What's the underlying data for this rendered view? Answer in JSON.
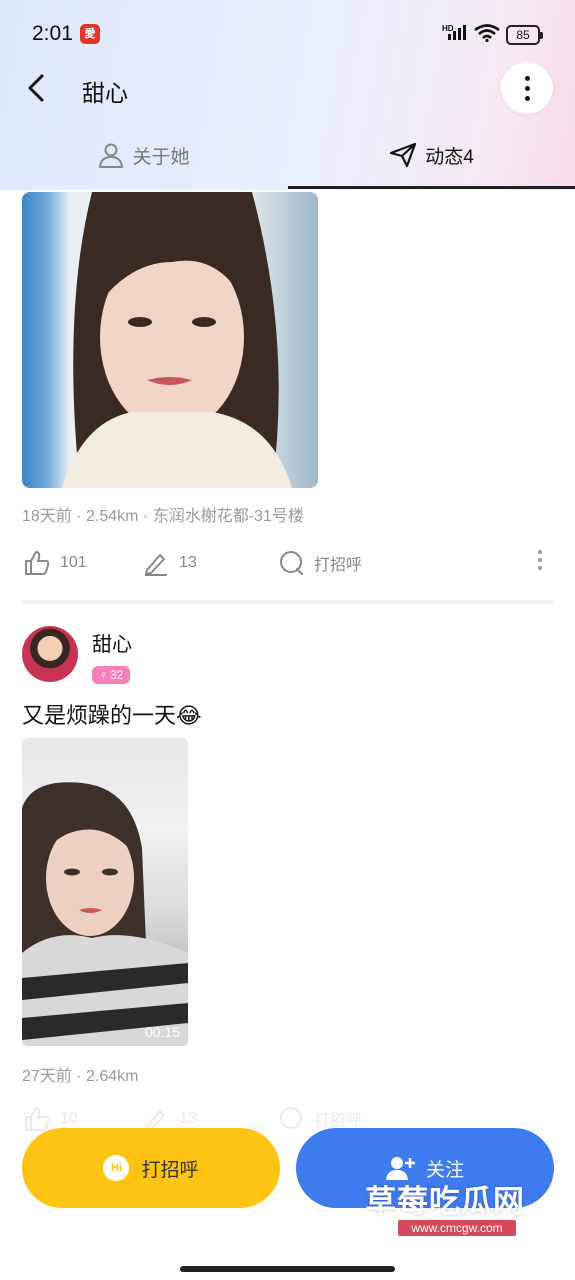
{
  "status_bar": {
    "time": "2:01",
    "app_badge": "愛",
    "signal_label": "HD",
    "battery": "85"
  },
  "nav": {
    "title": "甜心"
  },
  "tabs": {
    "about_label": "关于她",
    "feed_label": "动态4"
  },
  "posts": [
    {
      "meta": "18天前 · 2.54km · 东润水榭花都-31号楼",
      "likes": "101",
      "comments": "13",
      "greet_label": "打招呼"
    },
    {
      "author": "甜心",
      "age": "32",
      "text": "又是烦躁的一天😂",
      "video_duration": "00:15",
      "meta": "27天前 · 2.64km",
      "likes": "10",
      "comments": "13",
      "greet_label": "打招呼"
    }
  ],
  "bottom": {
    "hi_label": "打招呼",
    "hi_icon_text": "Hi",
    "follow_label": "关注"
  },
  "watermark": {
    "text": "草莓吃瓜网",
    "url": "www.cmcgw.com"
  },
  "colors": {
    "accent_yellow": "#fdc414",
    "accent_blue": "#3f7cf0",
    "badge_pink": "#f77fbb"
  }
}
